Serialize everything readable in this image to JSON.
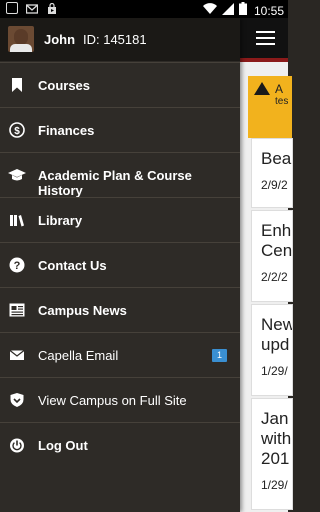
{
  "status_bar": {
    "time": "10:55",
    "icons": [
      "image-notification-icon",
      "gmail-icon",
      "store-icon",
      "wifi-icon",
      "signal-icon",
      "battery-icon"
    ]
  },
  "profile": {
    "name": "John",
    "id_label": "ID: 145181"
  },
  "menu": {
    "items": [
      {
        "label": "Courses",
        "icon": "bookmark-icon",
        "bold": true
      },
      {
        "label": "Finances",
        "icon": "dollar-icon",
        "bold": true
      },
      {
        "label": "Academic Plan & Course History",
        "icon": "graduation-cap-icon",
        "bold": true
      },
      {
        "label": "Library",
        "icon": "books-icon",
        "bold": true
      },
      {
        "label": "Contact Us",
        "icon": "question-icon",
        "bold": true
      },
      {
        "label": "Campus News",
        "icon": "newspaper-icon",
        "bold": true
      },
      {
        "label": "Capella Email",
        "icon": "envelope-icon",
        "bold": false,
        "badge": "1"
      },
      {
        "label": "View Campus on Full Site",
        "icon": "shield-icon",
        "bold": false
      },
      {
        "label": "Log Out",
        "icon": "power-icon",
        "bold": true
      }
    ]
  },
  "background": {
    "alert": {
      "line1": "A",
      "line2": "tes"
    },
    "cards": [
      {
        "title": "Bea",
        "date": "2/9/2"
      },
      {
        "title": "Enh",
        "title2": "Cen",
        "date": "2/2/2"
      },
      {
        "title": "New",
        "title2": "upd",
        "date": "1/29/"
      },
      {
        "title": "Jan",
        "title2": "with",
        "title3": "201",
        "date": "1/29/"
      }
    ]
  },
  "colors": {
    "drawer_bg": "#2e2b27",
    "header_bg": "#1b1916",
    "topbar_bg": "#111111",
    "accent_red": "#8b1a1a",
    "alert_yellow": "#f2b21d",
    "badge_blue": "#3a8fd1"
  }
}
